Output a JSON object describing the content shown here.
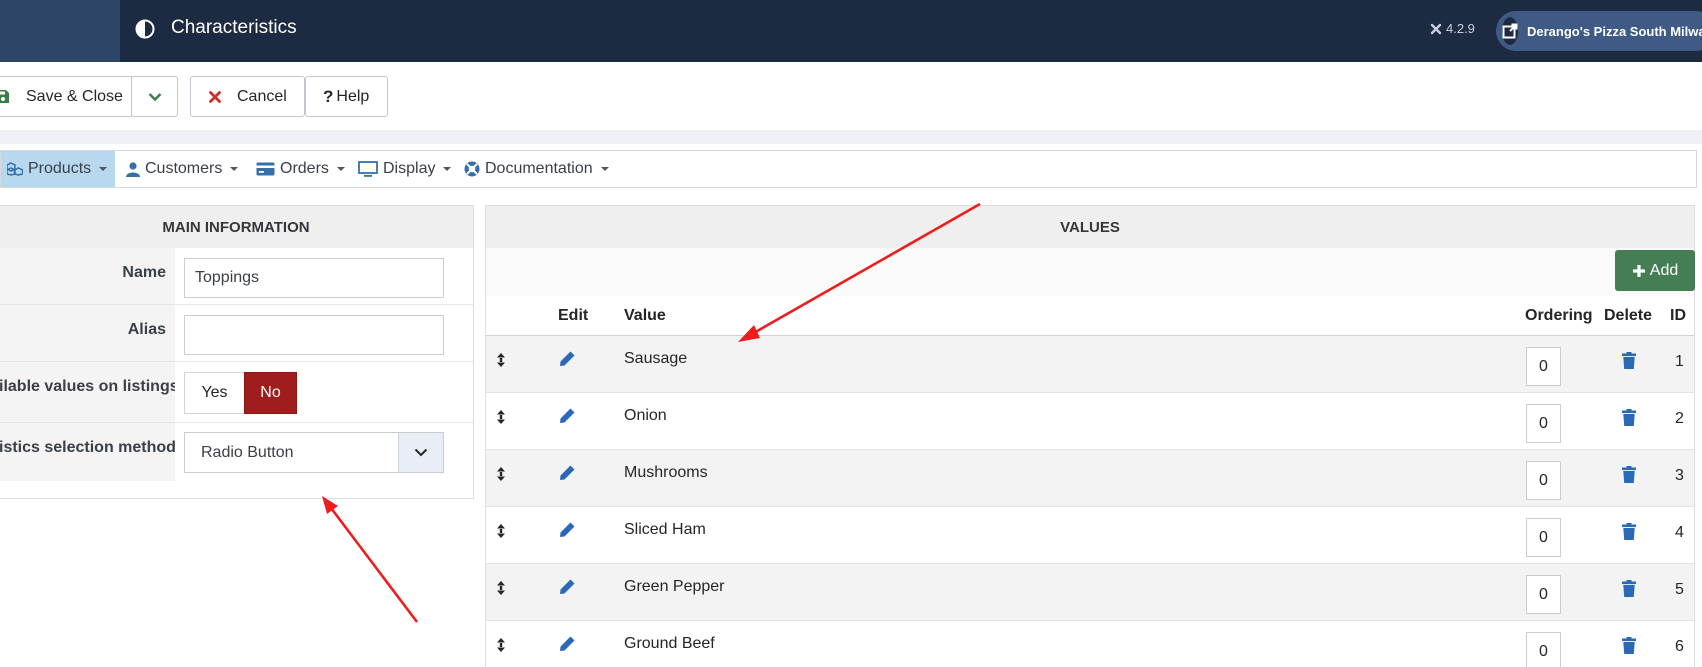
{
  "header": {
    "title": "Characteristics",
    "version": "4.2.9",
    "site_button": "Derango's Pizza South Milwau..."
  },
  "toolbar": {
    "save_close": "Save & Close",
    "cancel": "Cancel",
    "help": "Help"
  },
  "nav": {
    "products": "Products",
    "customers": "Customers",
    "orders": "Orders",
    "display": "Display",
    "documentation": "Documentation"
  },
  "main": {
    "heading": "MAIN INFORMATION",
    "name_label": "Name",
    "name_value": "Toppings",
    "alias_label": "Alias",
    "alias_value": "",
    "listings_label": "ilable values on listings",
    "yes": "Yes",
    "no": "No",
    "selection_label": "istics selection method",
    "selection_value": "Radio Button"
  },
  "values": {
    "heading": "VALUES",
    "add": "Add",
    "columns": {
      "edit": "Edit",
      "value": "Value",
      "ordering": "Ordering",
      "delete": "Delete",
      "id": "ID"
    },
    "rows": [
      {
        "value": "Sausage",
        "ordering": "0",
        "id": "1"
      },
      {
        "value": "Onion",
        "ordering": "0",
        "id": "2"
      },
      {
        "value": "Mushrooms",
        "ordering": "0",
        "id": "3"
      },
      {
        "value": "Sliced Ham",
        "ordering": "0",
        "id": "4"
      },
      {
        "value": "Green Pepper",
        "ordering": "0",
        "id": "5"
      },
      {
        "value": "Ground Beef",
        "ordering": "0",
        "id": "6"
      }
    ]
  },
  "icons": {
    "title": "half-circle-icon",
    "version": "joomla-icon",
    "site": "external-link-icon",
    "save": "save-icon",
    "dropdown": "chevron-down-icon",
    "cancel": "close-icon",
    "help": "question-icon",
    "products": "cubes-icon",
    "customers": "user-icon",
    "orders": "credit-card-icon",
    "display": "monitor-icon",
    "documentation": "lifebuoy-icon",
    "add": "plus-icon",
    "drag": "sort-icon",
    "edit": "pencil-icon",
    "delete": "trash-icon",
    "annotation": "red-arrow"
  },
  "colors": {
    "header": "#1c2a42",
    "no_active": "#9f1d1d",
    "add_button": "#457d54",
    "icon_blue": "#2a69b8",
    "annotation": "#ee1c1c"
  }
}
